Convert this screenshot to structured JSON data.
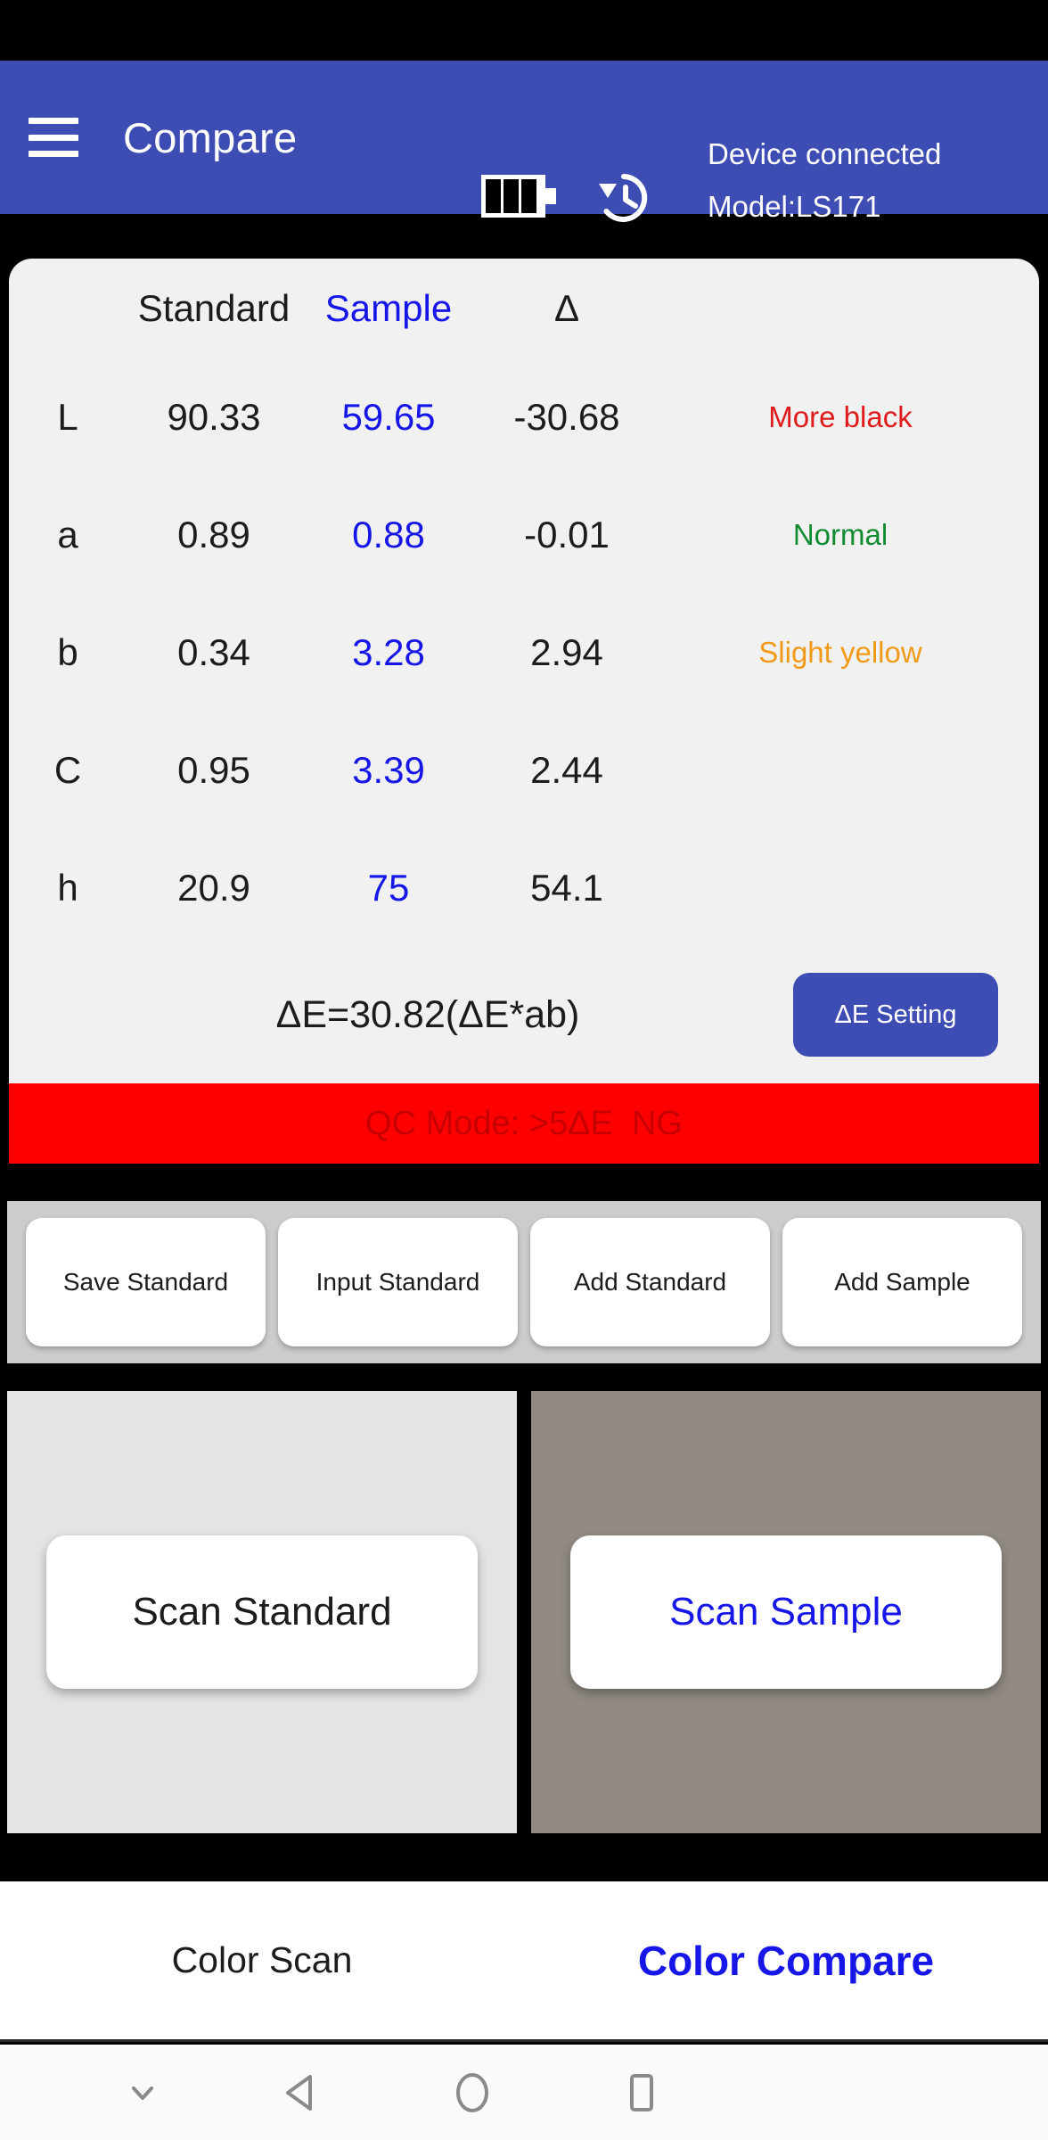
{
  "appbar": {
    "menu_icon": "hamburger-menu-icon",
    "title": "Compare",
    "battery_icon": "battery-icon",
    "history_icon": "history-clock-icon",
    "device_status": "Device connected",
    "device_model": "Model:LS171",
    "bg_color": "#3d4db3"
  },
  "table": {
    "headers": {
      "label": "",
      "standard": "Standard",
      "sample": "Sample",
      "delta": "Δ",
      "note": ""
    },
    "rows": [
      {
        "label": "L",
        "standard": "90.33",
        "sample": "59.65",
        "delta": "-30.68",
        "note": "More black",
        "note_color": "#e01b1b"
      },
      {
        "label": "a",
        "standard": "0.89",
        "sample": "0.88",
        "delta": "-0.01",
        "note": "Normal",
        "note_color": "#118b2f"
      },
      {
        "label": "b",
        "standard": "0.34",
        "sample": "3.28",
        "delta": "2.94",
        "note": "Slight yellow",
        "note_color": "#f09a18"
      },
      {
        "label": "C",
        "standard": "0.95",
        "sample": "3.39",
        "delta": "2.44",
        "note": "",
        "note_color": "#1c1c1c"
      },
      {
        "label": "h",
        "standard": "20.9",
        "sample": "75",
        "delta": "54.1",
        "note": "",
        "note_color": "#1c1c1c"
      }
    ],
    "delta_e_text": "ΔE=30.82(ΔE*ab)",
    "delta_e_setting_label": "ΔE Setting",
    "sample_color": "#1616e8"
  },
  "qc": {
    "text": "QC Mode: >5ΔE  NG",
    "bg_color": "#fe0000",
    "text_color": "#c60000"
  },
  "actions": [
    {
      "label": "Save Standard"
    },
    {
      "label": "Input Standard"
    },
    {
      "label": "Add Standard"
    },
    {
      "label": "Add Sample"
    }
  ],
  "panels": {
    "standard": {
      "swatch_color": "#e4e4e2",
      "button_label": "Scan Standard",
      "button_text_color": "#1c1c1c"
    },
    "sample": {
      "swatch_color": "#918b84",
      "button_label": "Scan Sample",
      "button_text_color": "#1616e8"
    }
  },
  "tabs": [
    {
      "label": "Color Scan",
      "active": false
    },
    {
      "label": "Color Compare",
      "active": true
    }
  ],
  "navbar": {
    "collapse_icon": "chevron-down-icon",
    "back_icon": "back-triangle-icon",
    "home_icon": "home-circle-icon",
    "recents_icon": "recents-square-icon"
  }
}
